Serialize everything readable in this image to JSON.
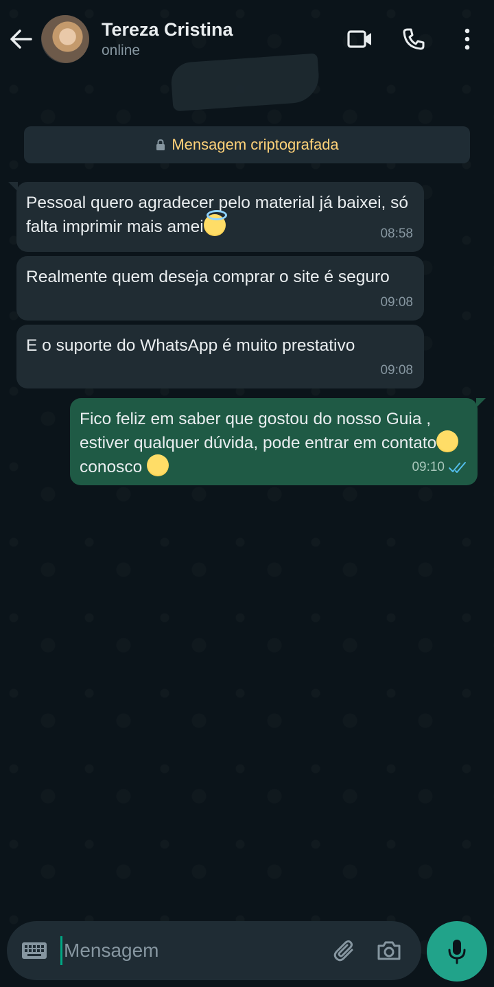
{
  "header": {
    "contact_name": "Tereza Cristina",
    "status": "online"
  },
  "notice": {
    "text": "Mensagem criptografada"
  },
  "messages": [
    {
      "direction": "in",
      "text": "Pessoal quero agradecer pelo material já baixei, só falta imprimir mais amei",
      "emoji": "smiling-face-with-halo",
      "time": "08:58"
    },
    {
      "direction": "in",
      "text": "Realmente quem deseja comprar o site é seguro",
      "time": "09:08"
    },
    {
      "direction": "in",
      "text": "E o suporte do WhatsApp é muito prestativo",
      "time": "09:08"
    },
    {
      "direction": "out",
      "text_part1": "Fico feliz em saber que gostou do nosso Guia , estiver qualquer dúvida, pode entrar em contato",
      "text_part2": " conosco ",
      "emoji": "saluting-face",
      "time": "09:10",
      "read": true
    }
  ],
  "composer": {
    "placeholder": "Mensagem"
  },
  "colors": {
    "background": "#0b141a",
    "incoming_bubble": "#202c33",
    "outgoing_bubble": "#1f5a45",
    "accent": "#00a884",
    "notice_text": "#ffd279",
    "read_ticks": "#53bdeb"
  },
  "icons": [
    "back-arrow-icon",
    "video-call-icon",
    "phone-icon",
    "more-options-icon",
    "lock-icon",
    "keyboard-icon",
    "attach-icon",
    "camera-icon",
    "mic-icon",
    "double-check-icon"
  ]
}
